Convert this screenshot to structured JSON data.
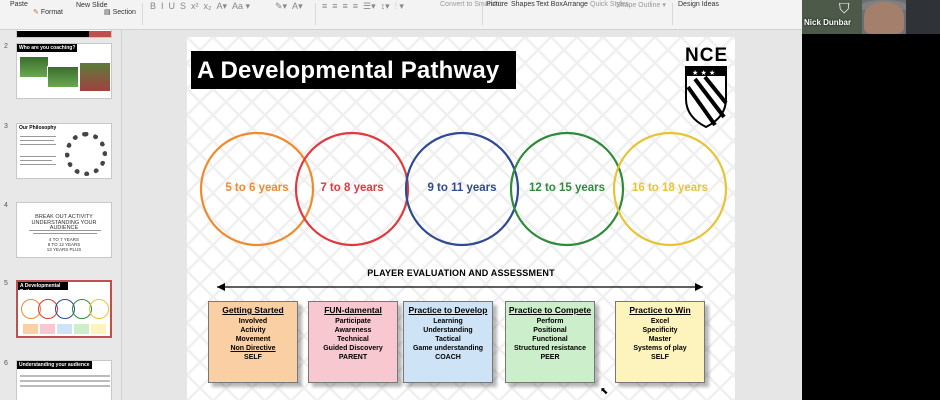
{
  "ribbon": {
    "paste": "Paste",
    "format": "Format",
    "new_slide": "New Slide",
    "section": "Section",
    "convert_smartart": "Convert to SmartArt",
    "picture": "Picture",
    "shapes": "Shapes",
    "text_box": "Text Box",
    "arrange": "Arrange",
    "quick_styles": "Quick Styles",
    "shape_outline": "Shape Outline",
    "design_ideas": "Design Ideas"
  },
  "sidebar": {
    "slides": [
      {
        "num": "2",
        "title": "Who are you coaching?"
      },
      {
        "num": "3",
        "title": "Our Philosophy"
      },
      {
        "num": "4",
        "lines": [
          "BREAK OUT ACTIVITY",
          "UNDERSTANDING YOUR AUDIENCE",
          "4 TO 7 YEARS",
          "8 TO 12 YEARS",
          "13 YEARS PLUS"
        ]
      },
      {
        "num": "5",
        "title": "A Developmental Pathway"
      },
      {
        "num": "6",
        "title": "Understanding your audience"
      }
    ]
  },
  "slide": {
    "title": "A Developmental Pathway",
    "logo": "NCE",
    "circles": [
      {
        "label": "5 to 6 years",
        "color": "#f08a2c"
      },
      {
        "label": "7 to 8 years",
        "color": "#e0393e"
      },
      {
        "label": "9 to 11 years",
        "color": "#2e4a92"
      },
      {
        "label": "12 to 15 years",
        "color": "#2e8b3a"
      },
      {
        "label": "16 to 18 years",
        "color": "#e6c435"
      }
    ],
    "evaluation": "PLAYER EVALUATION AND ASSESSMENT",
    "cards": [
      {
        "title": "Getting Started",
        "bg": "#f9cfa3",
        "lines": [
          "Involved",
          "Activity",
          "Movement",
          "Non Directive",
          "SELF"
        ]
      },
      {
        "title": "FUN-damental",
        "bg": "#f7c8cf",
        "lines": [
          "Participate",
          "Awareness",
          "Technical",
          "Guided Discovery",
          "PARENT"
        ]
      },
      {
        "title": "Practice to Develop",
        "bg": "#cfe3f7",
        "lines": [
          "Learning",
          "Understanding",
          "Tactical",
          "Game understanding",
          "COACH"
        ]
      },
      {
        "title": "Practice to Compete",
        "bg": "#cdeecb",
        "lines": [
          "Perform",
          "Positional",
          "Functional",
          "Structured resistance",
          "PEER"
        ]
      },
      {
        "title": "Practice to Win",
        "bg": "#fdf3bd",
        "lines": [
          "Excel",
          "Specificity",
          "Master",
          "Systems of play",
          "SELF"
        ]
      }
    ]
  },
  "video": {
    "name": "Nick Dunbar"
  }
}
